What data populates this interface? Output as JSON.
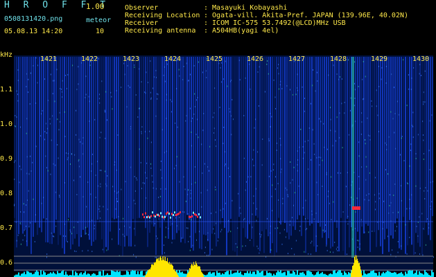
{
  "header": {
    "app_title": "H R O F F T",
    "version": "1.00",
    "filename": "0508131420.png",
    "mode": "meteor",
    "datetime": "05.08.13 14:20",
    "count": "10"
  },
  "info": {
    "labels": [
      "Observer",
      "Receiving Location",
      "Receiver",
      "Receiving antenna"
    ],
    "values": [
      ": Masayuki Kobayashi",
      ": Ogata-vill. Akita-Pref. JAPAN (139.96E, 40.02N)",
      ": ICOM IC-575 53.7492(@LCD)MHz USB",
      ": A504HB(yagi 4el)"
    ]
  },
  "spectrogram": {
    "unit_label": "kHz",
    "y_ticks": [
      "1.1",
      "1.0",
      "0.9",
      "0.8",
      "0.7",
      "0.6"
    ],
    "minute_labels": [
      "1421",
      "1422",
      "1423",
      "1424",
      "1425",
      "1426",
      "1427",
      "1428",
      "1429",
      "1430"
    ],
    "colors": {
      "background": "#00103a",
      "signal": "#1a4aff",
      "echo": "#ff2a3a",
      "power": "#ffe600",
      "noise": "#00e5ff"
    }
  }
}
